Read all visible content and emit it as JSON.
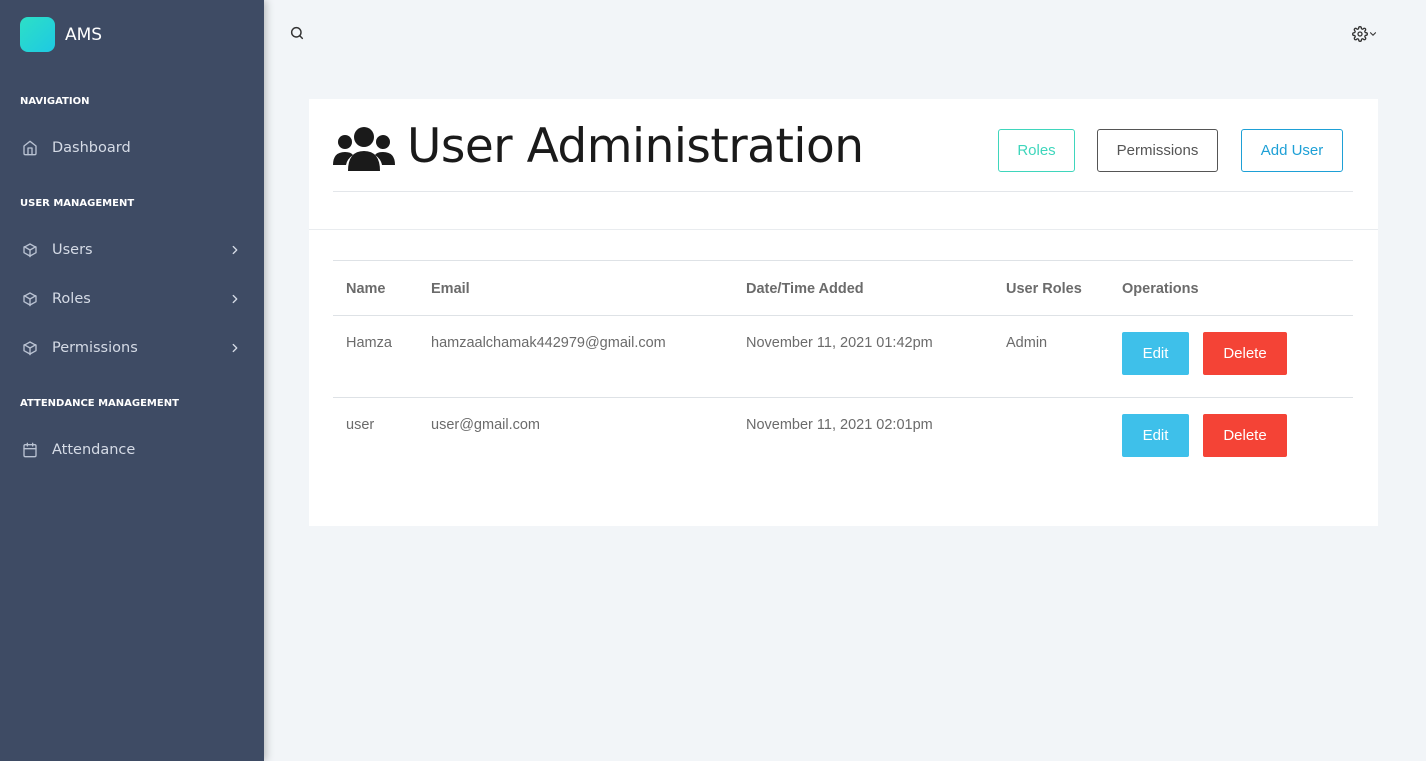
{
  "brand": {
    "name": "AMS",
    "logo_color": "#2de0c6"
  },
  "sidebar": {
    "sections": [
      {
        "label": "NAVIGATION"
      },
      {
        "label": "USER MANAGEMENT"
      },
      {
        "label": "ATTENDANCE MANAGEMENT"
      }
    ],
    "items": [
      {
        "label": "Dashboard",
        "icon": "home-icon"
      },
      {
        "label": "Users",
        "icon": "cube-icon",
        "has_submenu": true
      },
      {
        "label": "Roles",
        "icon": "cube-icon",
        "has_submenu": true
      },
      {
        "label": "Permissions",
        "icon": "cube-icon",
        "has_submenu": true
      },
      {
        "label": "Attendance",
        "icon": "calendar-icon"
      }
    ]
  },
  "topbar": {
    "search_icon": "search-icon",
    "settings_icon": "gear-icon"
  },
  "page": {
    "title": "User Administration",
    "title_icon": "users-icon",
    "buttons": {
      "roles": "Roles",
      "permissions": "Permissions",
      "add_user": "Add User"
    }
  },
  "table": {
    "headers": [
      "Name",
      "Email",
      "Date/Time Added",
      "User Roles",
      "Operations"
    ],
    "rows": [
      {
        "name": "Hamza",
        "email": "hamzaalchamak442979@gmail.com",
        "date": "November 11, 2021 01:42pm",
        "roles": "Admin",
        "edit": "Edit",
        "delete": "Delete"
      },
      {
        "name": "user",
        "email": "user@gmail.com",
        "date": "November 11, 2021 02:01pm",
        "roles": "",
        "edit": "Edit",
        "delete": "Delete"
      }
    ]
  },
  "colors": {
    "sidebar_bg": "#3e4b64",
    "edit": "#3ec0ea",
    "delete": "#f44336",
    "roles_accent": "#3fd6bc",
    "add_accent": "#1ea0d6"
  }
}
